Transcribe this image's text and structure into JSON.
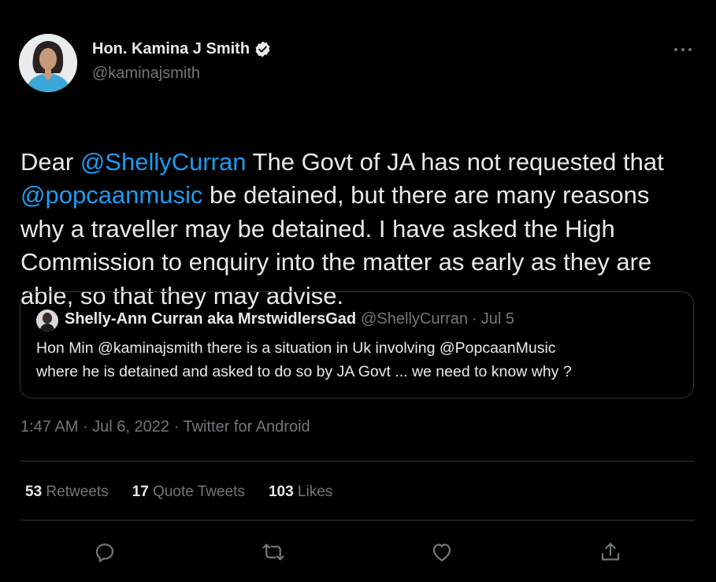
{
  "author": {
    "name": "Hon. Kamina J Smith",
    "handle": "@kaminajsmith",
    "avatar_icon": "profile-photo",
    "verified_icon": "verified-badge-icon"
  },
  "tweet": {
    "parts": [
      {
        "text": "Dear ",
        "type": "text"
      },
      {
        "text": "@ShellyCurran",
        "type": "mention"
      },
      {
        "text": " The Govt of JA has not requested that ",
        "type": "text"
      },
      {
        "text": "@popcaanmusic",
        "type": "mention"
      },
      {
        "text": " be detained, but there are many reasons why a traveller may be detained.  I have asked the High Commission to enquiry into the matter as early as they are able, so that they may advise.",
        "type": "text"
      }
    ]
  },
  "quote": {
    "name": "Shelly-Ann Curran aka MrstwidlersGad",
    "handle": "@ShellyCurran",
    "separator": "·",
    "date": "Jul 5",
    "text": "Hon Min @kaminajsmith there is a situation in Uk involving @PopcaanMusic\nwhere he is detained and asked to do so by JA Govt ... we need to know why ?"
  },
  "meta": {
    "time": "1:47 AM",
    "date": "Jul 6, 2022",
    "source": "Twitter for Android"
  },
  "stats": {
    "retweets_count": "53",
    "retweets_label": "Retweets",
    "quotes_count": "17",
    "quotes_label": "Quote Tweets",
    "likes_count": "103",
    "likes_label": "Likes"
  },
  "actions": [
    "reply-icon",
    "retweet-icon",
    "like-icon",
    "share-icon"
  ],
  "colors": {
    "background": "#000000",
    "text": "#e7e9ea",
    "muted": "#71767b",
    "link": "#1d9bf0",
    "border": "#2f3336"
  }
}
